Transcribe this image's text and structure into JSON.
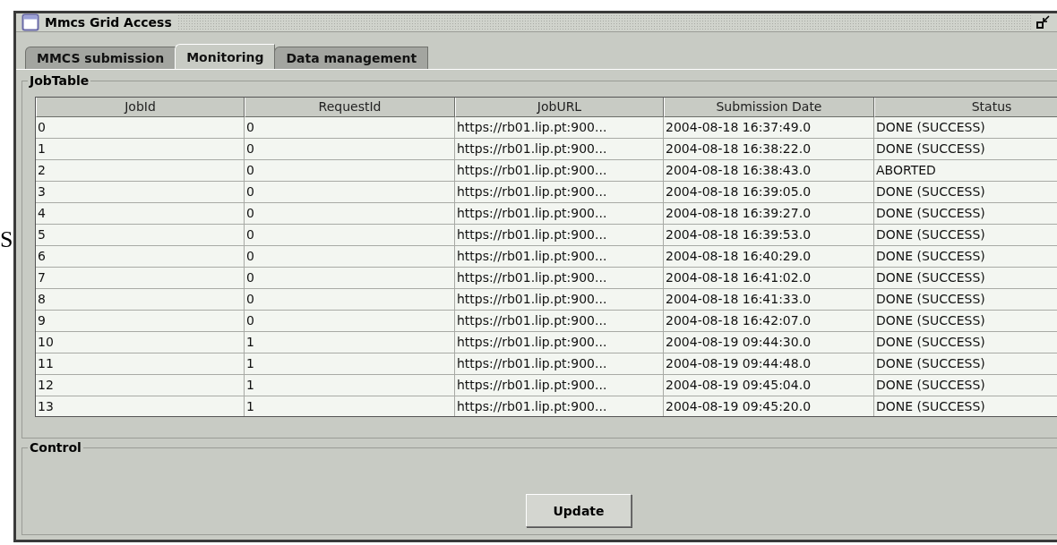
{
  "background_text": "S",
  "window": {
    "title": "Mmcs Grid Access"
  },
  "tabs": [
    {
      "label": "MMCS submission",
      "selected": false
    },
    {
      "label": "Monitoring",
      "selected": true
    },
    {
      "label": "Data management",
      "selected": false
    }
  ],
  "job_table": {
    "title": "JobTable",
    "columns": [
      "JobId",
      "RequestId",
      "JobURL",
      "Submission Date",
      "Status"
    ],
    "rows": [
      [
        "0",
        "0",
        "https://rb01.lip.pt:900...",
        "2004-08-18 16:37:49.0",
        "DONE (SUCCESS)"
      ],
      [
        "1",
        "0",
        "https://rb01.lip.pt:900...",
        "2004-08-18 16:38:22.0",
        "DONE (SUCCESS)"
      ],
      [
        "2",
        "0",
        "https://rb01.lip.pt:900...",
        "2004-08-18 16:38:43.0",
        "ABORTED"
      ],
      [
        "3",
        "0",
        "https://rb01.lip.pt:900...",
        "2004-08-18 16:39:05.0",
        "DONE (SUCCESS)"
      ],
      [
        "4",
        "0",
        "https://rb01.lip.pt:900...",
        "2004-08-18 16:39:27.0",
        "DONE (SUCCESS)"
      ],
      [
        "5",
        "0",
        "https://rb01.lip.pt:900...",
        "2004-08-18 16:39:53.0",
        "DONE (SUCCESS)"
      ],
      [
        "6",
        "0",
        "https://rb01.lip.pt:900...",
        "2004-08-18 16:40:29.0",
        "DONE (SUCCESS)"
      ],
      [
        "7",
        "0",
        "https://rb01.lip.pt:900...",
        "2004-08-18 16:41:02.0",
        "DONE (SUCCESS)"
      ],
      [
        "8",
        "0",
        "https://rb01.lip.pt:900...",
        "2004-08-18 16:41:33.0",
        "DONE (SUCCESS)"
      ],
      [
        "9",
        "0",
        "https://rb01.lip.pt:900...",
        "2004-08-18 16:42:07.0",
        "DONE (SUCCESS)"
      ],
      [
        "10",
        "1",
        "https://rb01.lip.pt:900...",
        "2004-08-19 09:44:30.0",
        "DONE (SUCCESS)"
      ],
      [
        "11",
        "1",
        "https://rb01.lip.pt:900...",
        "2004-08-19 09:44:48.0",
        "DONE (SUCCESS)"
      ],
      [
        "12",
        "1",
        "https://rb01.lip.pt:900...",
        "2004-08-19 09:45:04.0",
        "DONE (SUCCESS)"
      ],
      [
        "13",
        "1",
        "https://rb01.lip.pt:900...",
        "2004-08-19 09:45:20.0",
        "DONE (SUCCESS)"
      ]
    ]
  },
  "control": {
    "title": "Control",
    "button": "Update"
  }
}
